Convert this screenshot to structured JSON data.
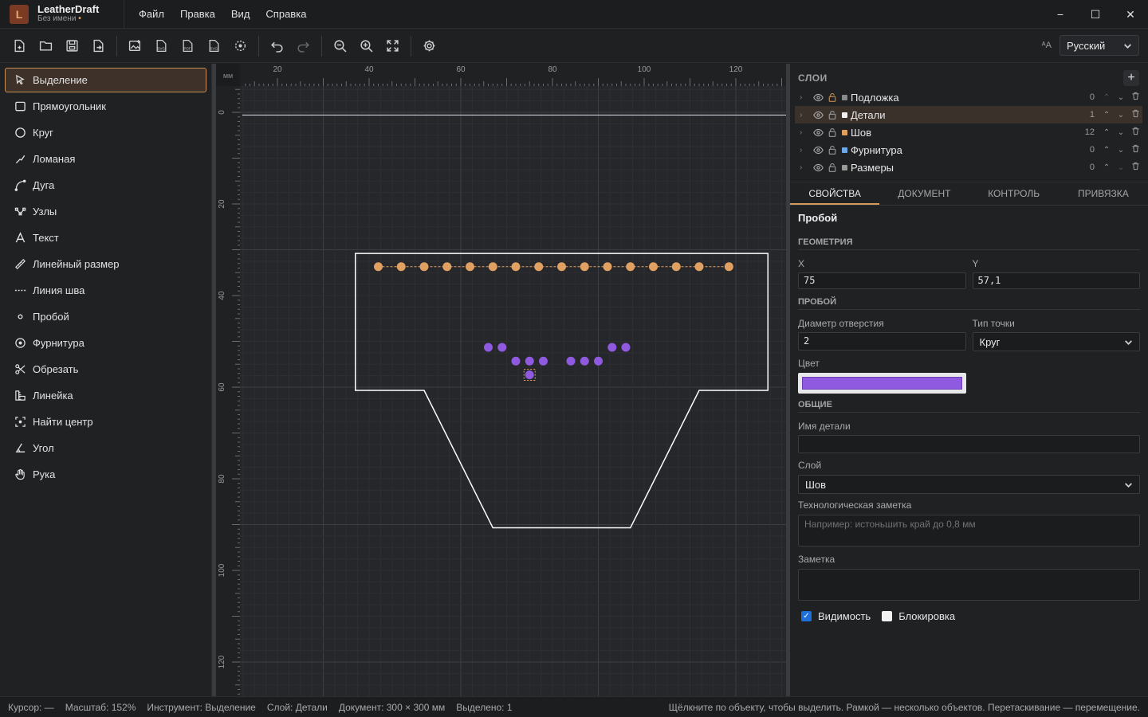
{
  "app": {
    "name": "LeatherDraft",
    "document": "Без имени",
    "unsaved_mark": "•",
    "logo_letter": "L"
  },
  "menu": [
    "Файл",
    "Правка",
    "Вид",
    "Справка"
  ],
  "window_controls": {
    "minimize": "−",
    "maximize": "☐",
    "close": "✕"
  },
  "toolbar": {
    "icons": [
      "new-file-icon",
      "open-file-icon",
      "save-icon",
      "save-as-icon",
      "export-image-icon",
      "export-svg-icon",
      "export-pdf-icon",
      "export-svg-alt-icon",
      "center-view-icon",
      "undo-icon",
      "redo-icon",
      "zoom-out-icon",
      "zoom-in-icon",
      "fit-view-icon",
      "settings-icon"
    ],
    "language_label": "Русский",
    "language_icon_text": "ᴬA"
  },
  "tools": [
    {
      "label": "Выделение",
      "icon": "select-arrow-icon",
      "active": true
    },
    {
      "label": "Прямоугольник",
      "icon": "rectangle-icon"
    },
    {
      "label": "Круг",
      "icon": "circle-icon"
    },
    {
      "label": "Ломаная",
      "icon": "polyline-icon"
    },
    {
      "label": "Дуга",
      "icon": "arc-icon"
    },
    {
      "label": "Узлы",
      "icon": "nodes-icon"
    },
    {
      "label": "Текст",
      "icon": "text-icon"
    },
    {
      "label": "Линейный размер",
      "icon": "dimension-icon"
    },
    {
      "label": "Линия шва",
      "icon": "stitch-line-icon"
    },
    {
      "label": "Пробой",
      "icon": "punch-icon"
    },
    {
      "label": "Фурнитура",
      "icon": "hardware-icon"
    },
    {
      "label": "Обрезать",
      "icon": "scissors-icon"
    },
    {
      "label": "Линейка",
      "icon": "ruler-icon"
    },
    {
      "label": "Найти центр",
      "icon": "find-center-icon"
    },
    {
      "label": "Угол",
      "icon": "angle-icon"
    },
    {
      "label": "Рука",
      "icon": "hand-icon"
    }
  ],
  "canvas": {
    "unit": "мм",
    "ruler_x_ticks": [
      "20",
      "40",
      "60",
      "80",
      "100",
      "120"
    ],
    "ruler_y_ticks": [
      "0",
      "20",
      "40",
      "60",
      "80",
      "100",
      "120"
    ]
  },
  "layers": {
    "title": "СЛОИ",
    "add_label": "+",
    "items": [
      {
        "name": "Подложка",
        "count": "0",
        "color": "#8a8a8a",
        "selected": false
      },
      {
        "name": "Детали",
        "count": "1",
        "color": "#f0f0f0",
        "selected": true
      },
      {
        "name": "Шов",
        "count": "12",
        "color": "#e0a061",
        "selected": false
      },
      {
        "name": "Фурнитура",
        "count": "0",
        "color": "#6fa8e8",
        "selected": false
      },
      {
        "name": "Размеры",
        "count": "0",
        "color": "#9a9a9a",
        "selected": false
      }
    ]
  },
  "tabs": [
    "СВОЙСТВА",
    "ДОКУМЕНТ",
    "КОНТРОЛЬ",
    "ПРИВЯЗКА"
  ],
  "properties": {
    "title": "Пробой",
    "geometry_section": "ГЕОМЕТРИЯ",
    "x_label": "X",
    "x_value": "75",
    "y_label": "Y",
    "y_value": "57,1",
    "punch_section": "ПРОБОЙ",
    "diameter_label": "Диаметр отверстия",
    "diameter_value": "2",
    "point_type_label": "Тип точки",
    "point_type_value": "Круг",
    "color_label": "Цвет",
    "color_value": "#8f5ae0",
    "general_section": "ОБЩИЕ",
    "part_name_label": "Имя детали",
    "part_name_value": "",
    "layer_label": "Слой",
    "layer_value": "Шов",
    "tech_note_label": "Технологическая заметка",
    "tech_note_placeholder": "Например: истоньшить край до 0,8 мм",
    "note_label": "Заметка",
    "note_placeholder": "",
    "visibility_label": "Видимость",
    "visibility_checked": true,
    "lock_label": "Блокировка",
    "lock_checked": false
  },
  "status": {
    "cursor": "Курсор: —",
    "zoom": "Масштаб: 152%",
    "tool": "Инструмент: Выделение",
    "layer": "Слой: Детали",
    "document": "Документ: 300 × 300 мм",
    "selected": "Выделено: 1",
    "hint": "Щёлкните по объекту, чтобы выделить. Рамкой — несколько объектов. Перетаскивание — перемещение."
  },
  "colors": {
    "accent": "#d39a5d",
    "stitch_holes": "#e0a061",
    "punch_holes": "#8f5ae0",
    "outline": "#ffffff"
  }
}
